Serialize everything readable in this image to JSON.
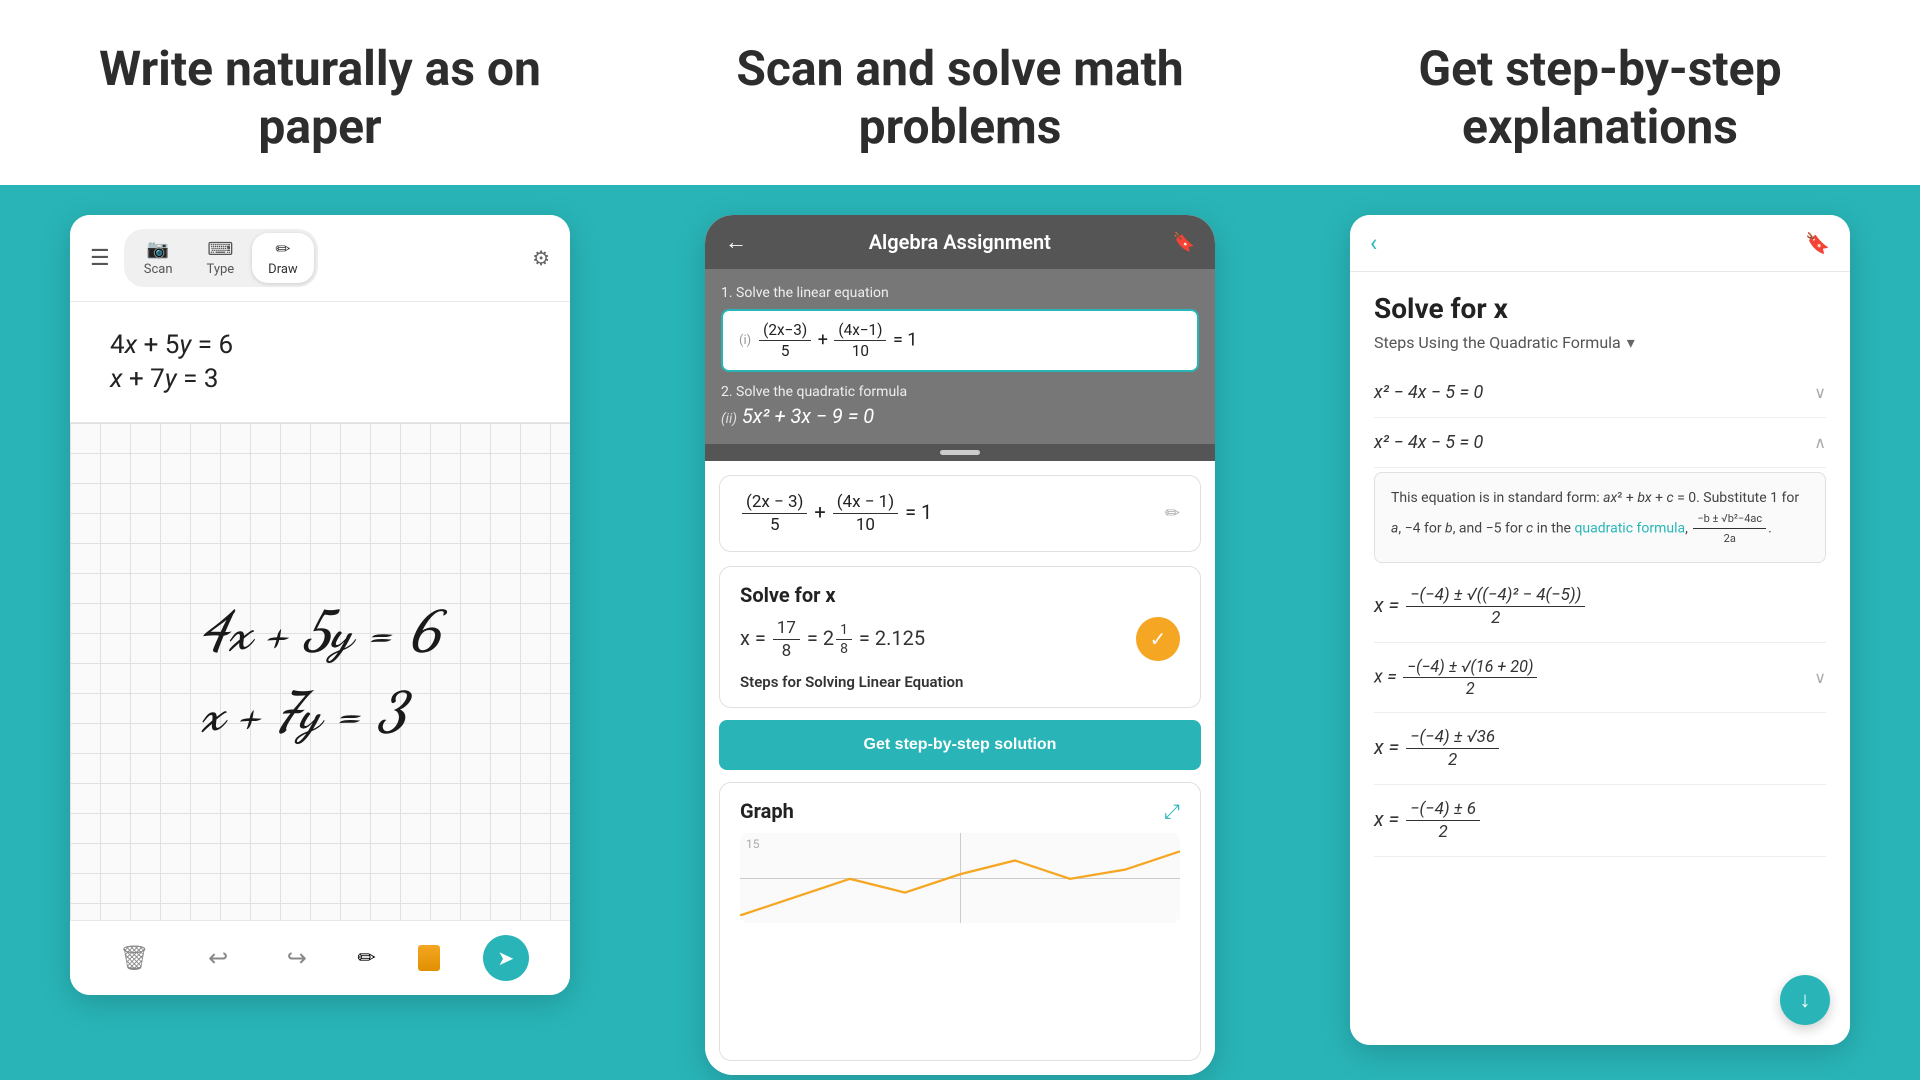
{
  "columns": [
    {
      "id": "col1",
      "header": "Write naturally as on paper",
      "toolbar": {
        "scan_label": "Scan",
        "type_label": "Type",
        "draw_label": "Draw",
        "scan_icon": "📷",
        "type_icon": "⌨",
        "draw_icon": "✏"
      },
      "typed_equations": [
        "4x + 5y = 6",
        "x + 7y = 3"
      ],
      "handwritten": [
        "4x + 5y = 6",
        "x + 7y = 3"
      ],
      "bottom_bar": {
        "trash": "🗑",
        "undo": "↩",
        "redo": "↪",
        "pencil": "✏",
        "send": "➤"
      }
    },
    {
      "id": "col2",
      "header": "Scan and solve math problems",
      "phone_title": "Algebra Assignment",
      "problem1_label": "1. Solve the linear equation",
      "problem1_eq": "(2x−3)/5 + (4x−1)/10 = 1",
      "problem2_label": "2. Solve the quadratic formula",
      "problem2_eq": "(ii) 5x² + 3x − 9 = 0",
      "result_eq": "(2x − 3)/5 + (4x − 1)/10 = 1",
      "solve_title": "Solve for x",
      "solve_result": "x = 17/8 = 2⅛ = 2.125",
      "steps_label": "Steps for Solving Linear Equation",
      "step_btn_label": "Get step-by-step solution",
      "graph_title": "Graph",
      "graph_y_label": "15"
    },
    {
      "id": "col3",
      "header": "Get step-by-step explanations",
      "solve_title": "Solve for x",
      "steps_using": "Steps Using the Quadratic Formula",
      "steps": [
        {
          "eq": "x² − 4x − 5 = 0",
          "expanded": false
        },
        {
          "eq": "x² − 4x − 5 = 0",
          "expanded": true,
          "explanation": "This equation is in standard form: ax² + bx + c = 0. Substitute 1 for a, −4 for b, and −5 for c in the quadratic formula, (−b ± √(b²−4ac)) / 2a."
        },
        {
          "eq": "x = (−(−4) ± √((−4)² − 4(−5))) / 2",
          "expanded": false
        },
        {
          "eq": "x = (−(−4) ± √(16 + 20)) / 2",
          "expanded": false
        },
        {
          "eq": "x = (−(−4) ± √36) / 2",
          "expanded": false
        },
        {
          "eq": "x = (−(−4) ± 6) / 2",
          "expanded": false
        }
      ],
      "quadratic_link": "quadratic formula"
    }
  ]
}
